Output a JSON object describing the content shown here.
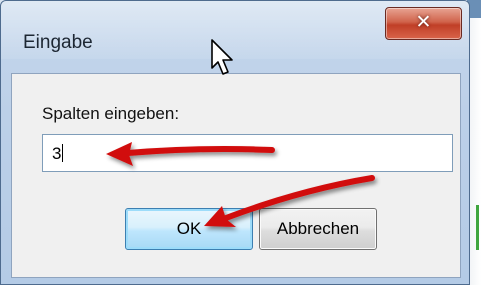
{
  "dialog": {
    "title": "Eingabe",
    "close_glyph": "✕",
    "prompt_label": "Spalten eingeben:",
    "input_value": "3",
    "ok_label": "OK",
    "cancel_label": "Abbrechen"
  },
  "colors": {
    "arrow": "#d10f0f",
    "ok_border": "#3c7fb1",
    "close_button": "#c03f27"
  }
}
